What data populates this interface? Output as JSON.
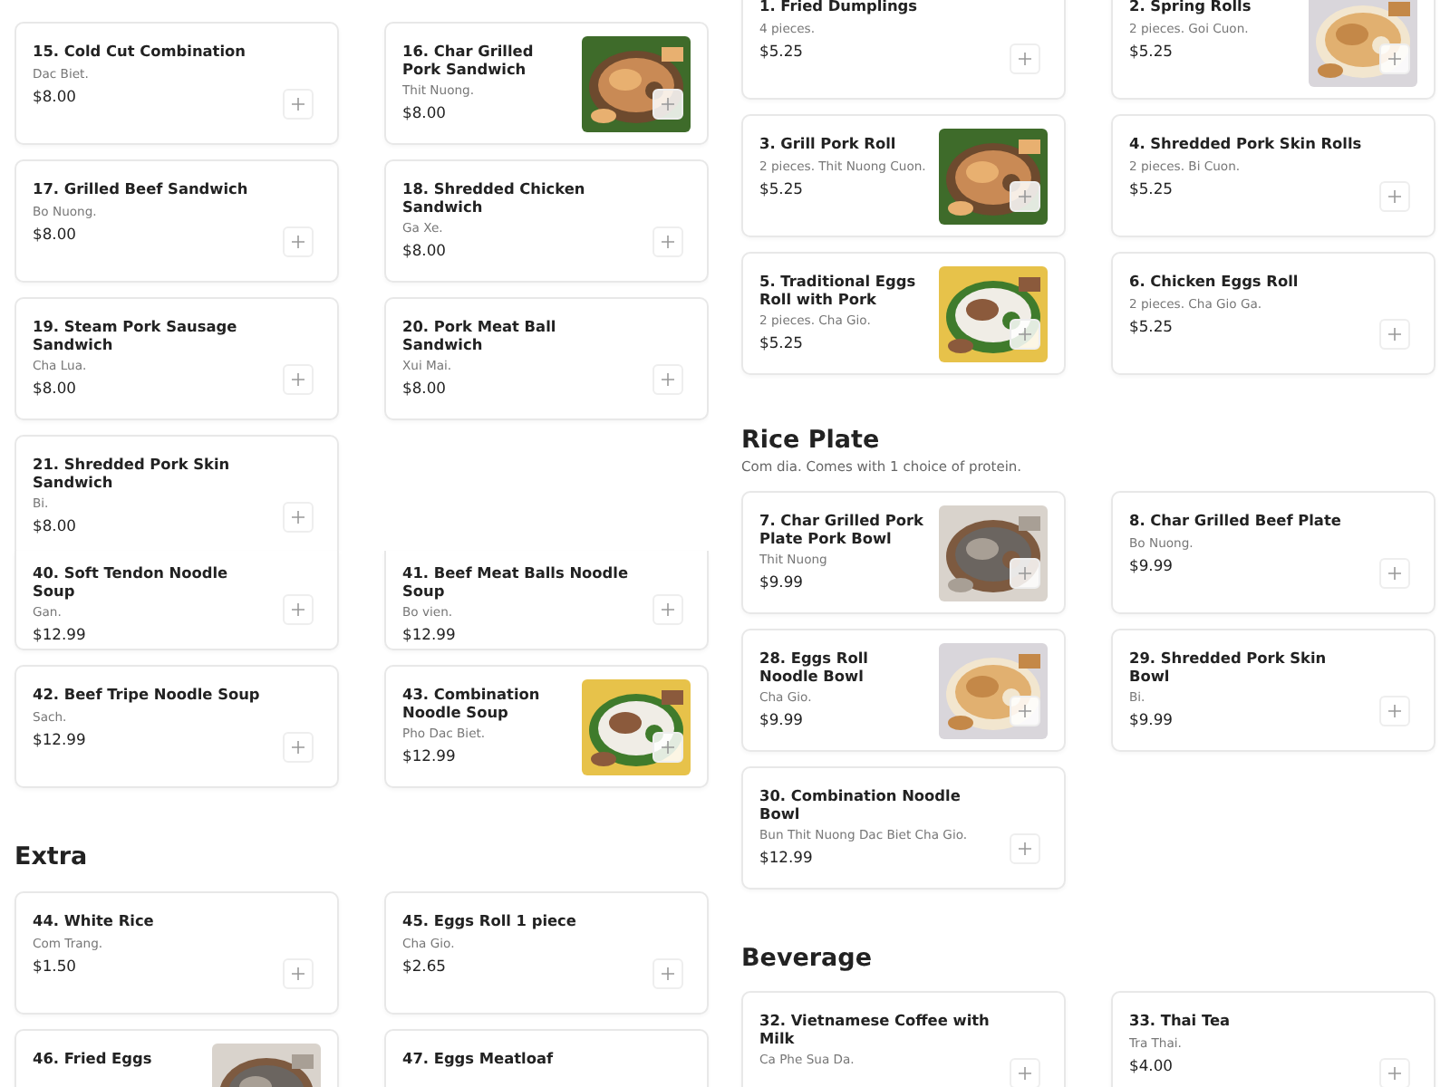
{
  "left_panel": {
    "sections": [
      {
        "items": [
          {
            "title": "15. Cold Cut Combination",
            "description": "Dac Biet.",
            "price": "$8.00"
          },
          {
            "title": "16. Char Grilled Pork Sandwich",
            "description": "Thit Nuong.",
            "price": "$8.00",
            "picture": true
          },
          {
            "title": "17. Grilled Beef Sandwich",
            "description": "Bo Nuong.",
            "price": "$8.00"
          },
          {
            "title": "18. Shredded Chicken Sandwich",
            "description": "Ga Xe.",
            "price": "$8.00"
          },
          {
            "title": "19. Steam Pork Sausage Sandwich",
            "description": "Cha Lua.",
            "price": "$8.00"
          },
          {
            "title": "20. Pork Meat Ball Sandwich",
            "description": "Xui Mai.",
            "price": "$8.00"
          },
          {
            "title": "21. Shredded Pork Skin Sandwich",
            "description": "Bi.",
            "price": "$8.00"
          }
        ]
      },
      {
        "items": [
          {
            "title": "40. Soft Tendon Noodle Soup",
            "description": "Gan.",
            "price": "$12.99"
          },
          {
            "title": "41. Beef Meat Balls Noodle Soup",
            "description": "Bo vien.",
            "price": "$12.99"
          },
          {
            "title": "42. Beef Tripe Noodle Soup",
            "description": "Sach.",
            "price": "$12.99"
          },
          {
            "title": "43. Combination Noodle Soup",
            "description": "Pho Dac Biet.",
            "price": "$12.99",
            "picture": true
          }
        ]
      },
      {
        "heading": "Extra",
        "items": [
          {
            "title": "44. White Rice",
            "description": "Com Trang.",
            "price": "$1.50"
          },
          {
            "title": "45. Eggs Roll 1 piece",
            "description": "Cha Gio.",
            "price": "$2.65"
          },
          {
            "title": "46. Fried Eggs",
            "picture": true
          },
          {
            "title": "47. Eggs Meatloaf"
          }
        ]
      }
    ]
  },
  "right_panel": {
    "sections": [
      {
        "items": [
          {
            "title": "1. Fried Dumplings",
            "description": "4 pieces.",
            "price": "$5.25"
          },
          {
            "title": "2. Spring Rolls",
            "description": "2 pieces. Goi Cuon.",
            "price": "$5.25",
            "picture": true
          },
          {
            "title": "3. Grill Pork Roll",
            "description": "2 pieces. Thit Nuong Cuon.",
            "price": "$5.25",
            "picture": true
          },
          {
            "title": "4. Shredded Pork Skin Rolls",
            "description": "2 pieces. Bi Cuon.",
            "price": "$5.25"
          },
          {
            "title": "5. Traditional Eggs Roll with Pork",
            "description": "2 pieces. Cha Gio.",
            "price": "$5.25",
            "picture": true
          },
          {
            "title": "6. Chicken Eggs Roll",
            "description": "2 pieces. Cha Gio Ga.",
            "price": "$5.25"
          }
        ]
      },
      {
        "heading": "Rice Plate",
        "description": "Com dia. Comes with 1 choice of protein.",
        "items": [
          {
            "title": "7. Char Grilled Pork Plate Pork Bowl",
            "description": "Thit Nuong",
            "price": "$9.99",
            "picture": true
          },
          {
            "title": "8. Char Grilled Beef Plate",
            "description": "Bo Nuong.",
            "price": "$9.99"
          },
          {
            "title": "28. Eggs Roll Noodle Bowl",
            "description": "Cha Gio.",
            "price": "$9.99",
            "picture": true
          },
          {
            "title": "29. Shredded Pork Skin Bowl",
            "description": "Bi.",
            "price": "$9.99"
          },
          {
            "title": "30. Combination Noodle Bowl",
            "description": "Bun Thit Nuong Dac Biet Cha Gio.",
            "price": "$12.99"
          }
        ]
      },
      {
        "heading": "Beverage",
        "items": [
          {
            "title": "32. Vietnamese Coffee with Milk",
            "description": "Ca Phe Sua Da."
          },
          {
            "title": "33. Thai Tea",
            "description": "Tra Thai.",
            "price": "$4.00"
          }
        ]
      }
    ]
  }
}
